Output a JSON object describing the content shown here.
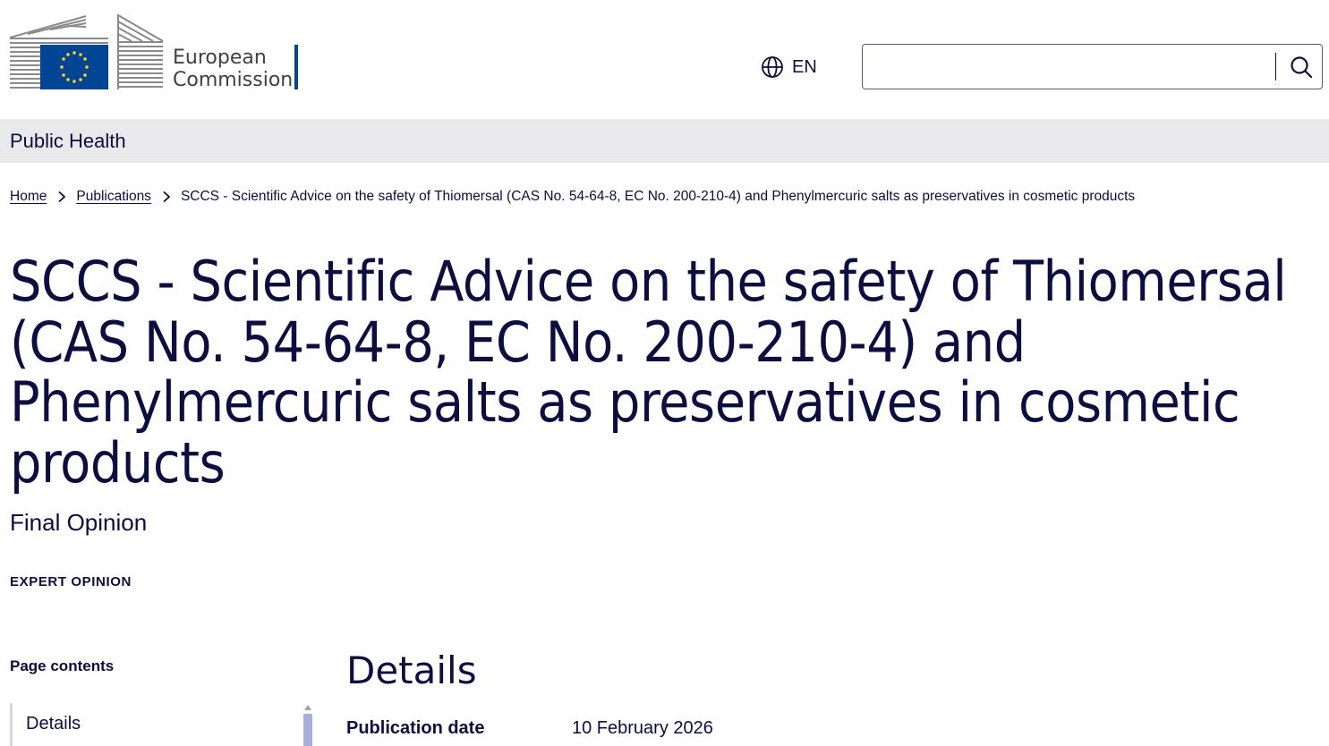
{
  "header": {
    "logo_line1": "European",
    "logo_line2": "Commission",
    "language": "EN",
    "search_placeholder": ""
  },
  "site": {
    "name": "Public Health"
  },
  "breadcrumb": {
    "items": [
      "Home",
      "Publications"
    ],
    "current": "SCCS - Scientific Advice on the safety of Thiomersal (CAS No. 54-64-8, EC No. 200-210-4) and Phenylmercuric salts as preservatives in cosmetic products"
  },
  "page": {
    "title": "SCCS - Scientific Advice on the safety of Thiomersal (CAS No. 54-64-8, EC No. 200-210-4) and Phenylmercuric salts as preservatives in cosmetic products",
    "subtitle": "Final Opinion",
    "type": "EXPERT OPINION"
  },
  "toc": {
    "title": "Page contents",
    "items": [
      "Details"
    ]
  },
  "details": {
    "title": "Details",
    "rows": [
      {
        "label": "Publication date",
        "value": "10 February 2026"
      }
    ]
  },
  "colors": {
    "text": "#0b0e3f",
    "eu_blue": "#004494",
    "eu_star": "#ffd617",
    "sitebar_bg": "#e9e9eb",
    "toc_thumb": "#a7b0da"
  },
  "icons": {
    "language": "globe-icon",
    "search": "search-icon",
    "breadcrumb_separator": "chevron-right-icon"
  }
}
